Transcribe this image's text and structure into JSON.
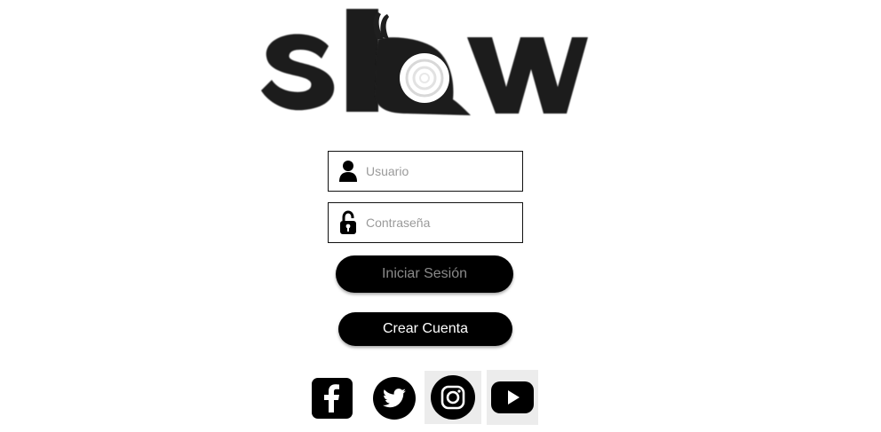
{
  "app": {
    "logo_text": "slow"
  },
  "login_form": {
    "username_placeholder": "Usuario",
    "password_placeholder": "Contraseña",
    "login_button_label": "Iniciar Sesión",
    "signup_button_label": "Crear Cuenta"
  },
  "social": [
    {
      "name": "facebook",
      "icon": "facebook-icon"
    },
    {
      "name": "twitter",
      "icon": "twitter-icon"
    },
    {
      "name": "instagram",
      "icon": "instagram-icon"
    },
    {
      "name": "youtube",
      "icon": "youtube-icon"
    }
  ],
  "colors": {
    "primary": "#000000",
    "text_on_button": "#ffffff",
    "muted_text": "#8a8a8a",
    "placeholder": "#9a9a9a"
  }
}
